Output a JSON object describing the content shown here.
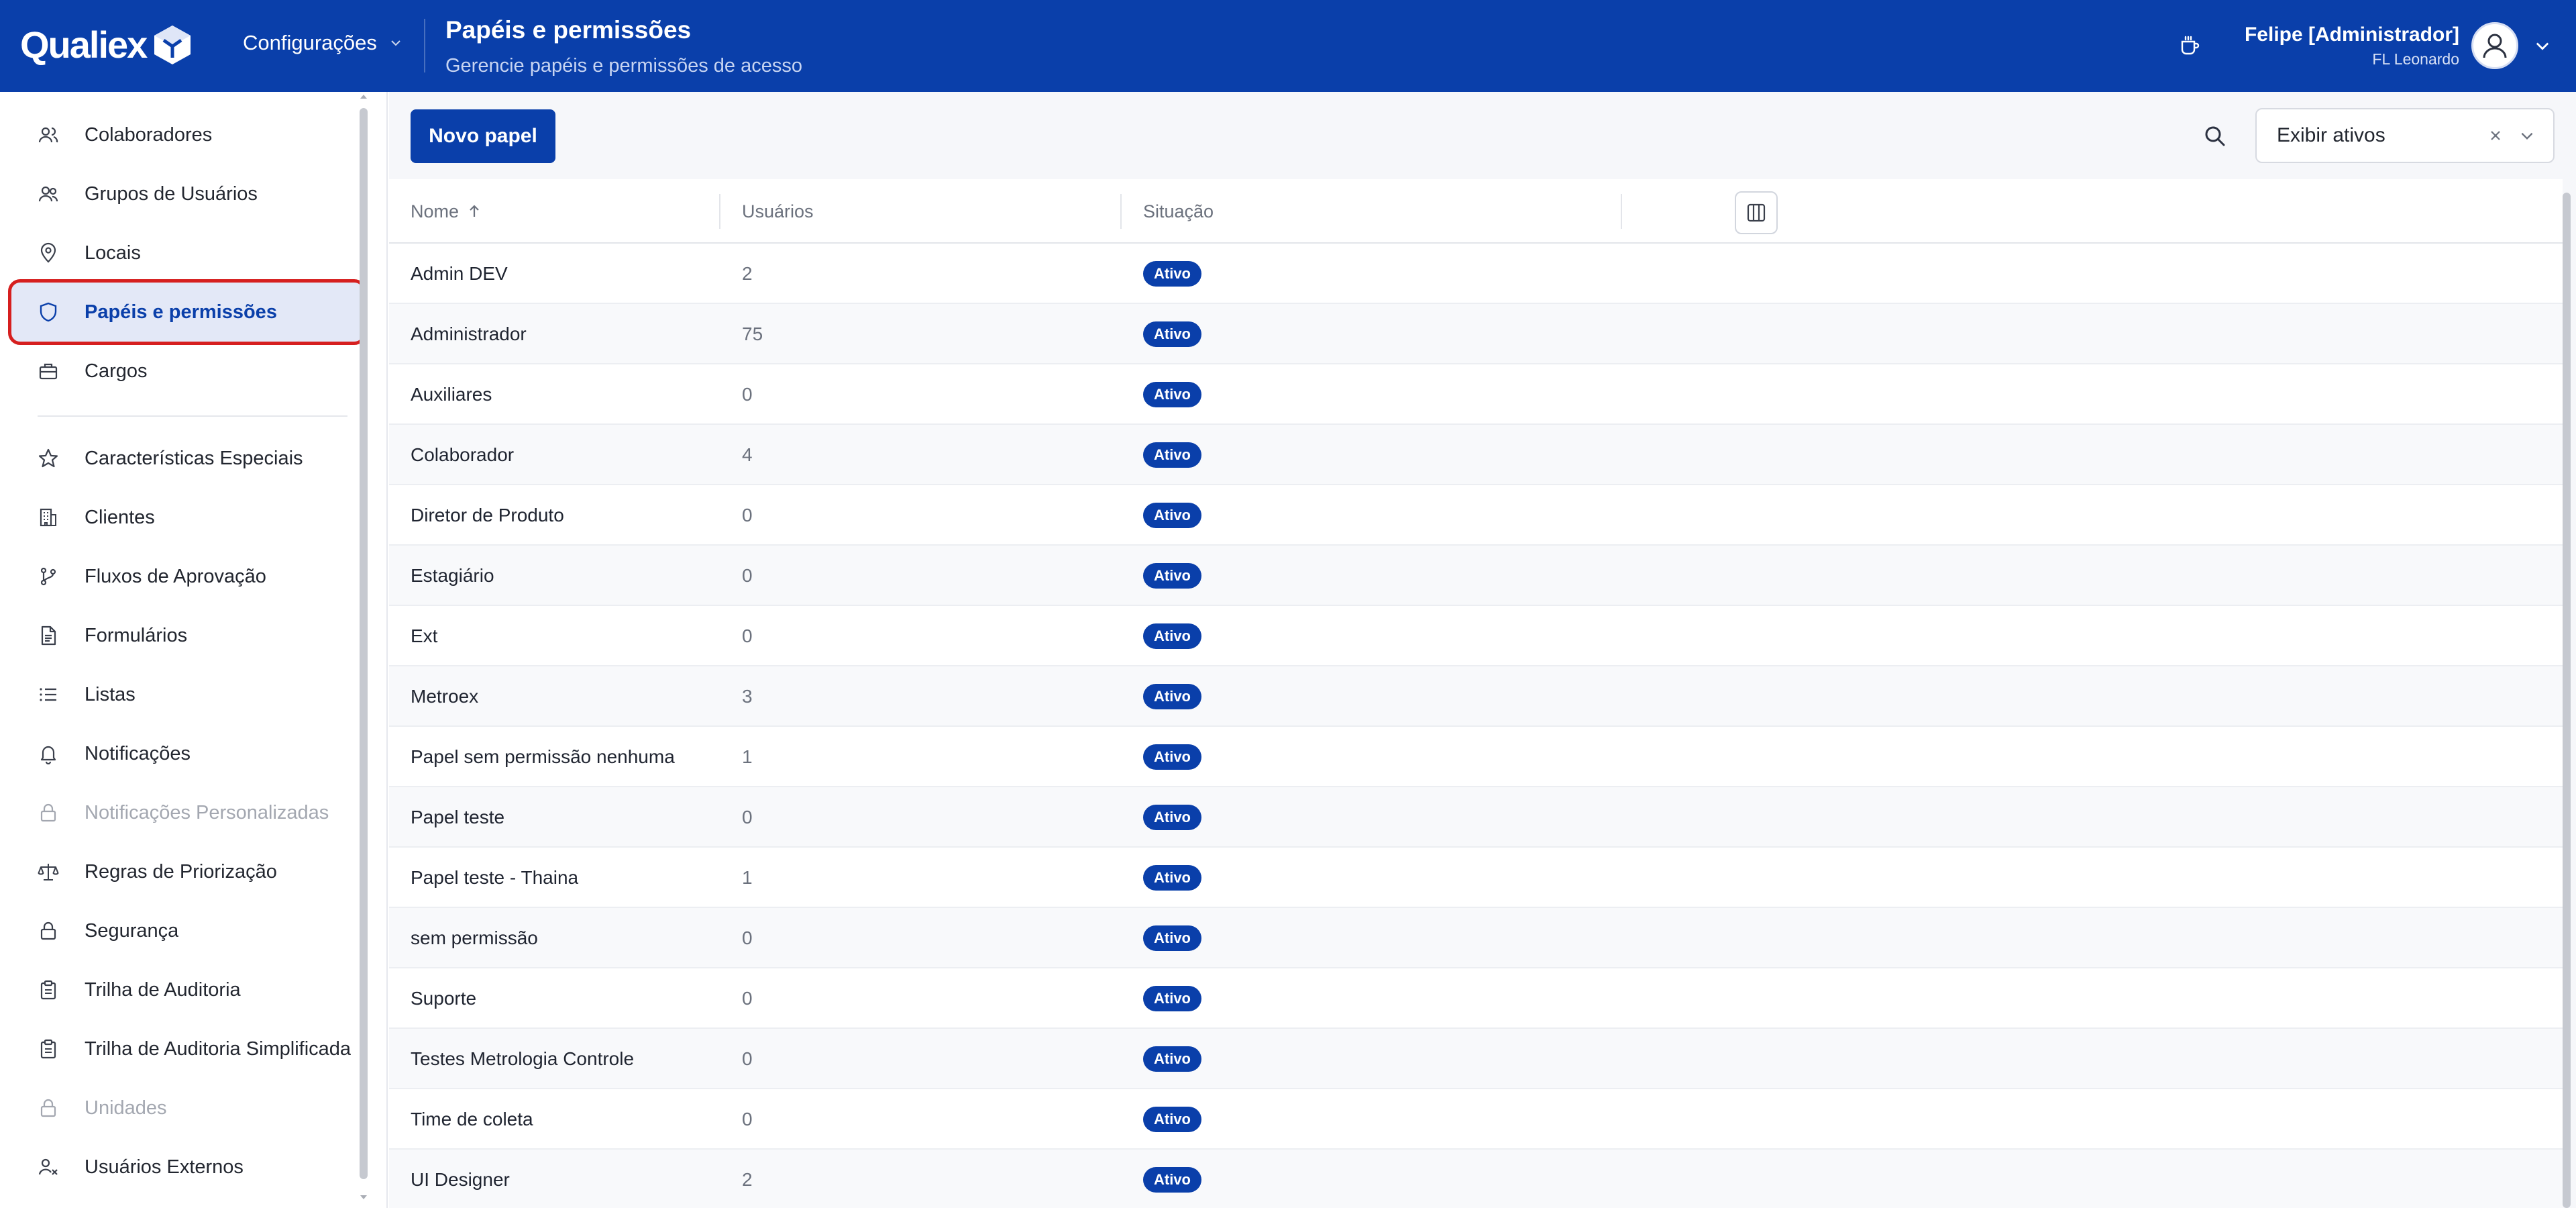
{
  "header": {
    "logo_text": "Qualiex",
    "module_label": "Configurações",
    "page_title": "Papéis e permissões",
    "page_subtitle": "Gerencie papéis e permissões de acesso",
    "user_name": "Felipe [Administrador]",
    "user_org": "FL Leonardo"
  },
  "sidebar": {
    "items": [
      {
        "label": "Colaboradores",
        "icon": "users-icon",
        "state": "normal"
      },
      {
        "label": "Grupos de Usuários",
        "icon": "user-group-icon",
        "state": "normal"
      },
      {
        "label": "Locais",
        "icon": "map-pin-icon",
        "state": "normal"
      },
      {
        "label": "Papéis e permissões",
        "icon": "shield-icon",
        "state": "active"
      },
      {
        "label": "Cargos",
        "icon": "briefcase-icon",
        "state": "normal"
      },
      {
        "label": "Características Especiais",
        "icon": "star-icon",
        "state": "normal"
      },
      {
        "label": "Clientes",
        "icon": "building-icon",
        "state": "normal"
      },
      {
        "label": "Fluxos de Aprovação",
        "icon": "git-branch-icon",
        "state": "normal"
      },
      {
        "label": "Formulários",
        "icon": "file-text-icon",
        "state": "normal"
      },
      {
        "label": "Listas",
        "icon": "list-icon",
        "state": "normal"
      },
      {
        "label": "Notificações",
        "icon": "bell-icon",
        "state": "normal"
      },
      {
        "label": "Notificações Personalizadas",
        "icon": "lock-icon",
        "state": "disabled"
      },
      {
        "label": "Regras de Priorização",
        "icon": "scale-icon",
        "state": "normal"
      },
      {
        "label": "Segurança",
        "icon": "lock-icon",
        "state": "normal"
      },
      {
        "label": "Trilha de Auditoria",
        "icon": "clipboard-icon",
        "state": "normal"
      },
      {
        "label": "Trilha de Auditoria Simplificada",
        "icon": "clipboard-icon",
        "state": "normal"
      },
      {
        "label": "Unidades",
        "icon": "lock-icon",
        "state": "disabled"
      },
      {
        "label": "Usuários Externos",
        "icon": "user-x-icon",
        "state": "normal"
      }
    ]
  },
  "toolbar": {
    "new_button_label": "Novo papel",
    "filter_value": "Exibir ativos"
  },
  "table": {
    "columns": [
      "Nome",
      "Usuários",
      "Situação"
    ],
    "rows": [
      {
        "name": "Admin DEV",
        "users": "2",
        "status": "Ativo"
      },
      {
        "name": "Administrador",
        "users": "75",
        "status": "Ativo"
      },
      {
        "name": "Auxiliares",
        "users": "0",
        "status": "Ativo"
      },
      {
        "name": "Colaborador",
        "users": "4",
        "status": "Ativo"
      },
      {
        "name": "Diretor de Produto",
        "users": "0",
        "status": "Ativo"
      },
      {
        "name": "Estagiário",
        "users": "0",
        "status": "Ativo"
      },
      {
        "name": "Ext",
        "users": "0",
        "status": "Ativo"
      },
      {
        "name": "Metroex",
        "users": "3",
        "status": "Ativo"
      },
      {
        "name": "Papel sem permissão nenhuma",
        "users": "1",
        "status": "Ativo"
      },
      {
        "name": "Papel teste",
        "users": "0",
        "status": "Ativo"
      },
      {
        "name": "Papel teste - Thaina",
        "users": "1",
        "status": "Ativo"
      },
      {
        "name": "sem permissão",
        "users": "0",
        "status": "Ativo"
      },
      {
        "name": "Suporte",
        "users": "0",
        "status": "Ativo"
      },
      {
        "name": "Testes Metrologia Controle",
        "users": "0",
        "status": "Ativo"
      },
      {
        "name": "Time de coleta",
        "users": "0",
        "status": "Ativo"
      },
      {
        "name": "UI Designer",
        "users": "2",
        "status": "Ativo"
      }
    ]
  },
  "colors": {
    "brand": "#0a3faa",
    "active_bg": "#e3e8f7",
    "highlight_ring": "#d61f1f"
  }
}
